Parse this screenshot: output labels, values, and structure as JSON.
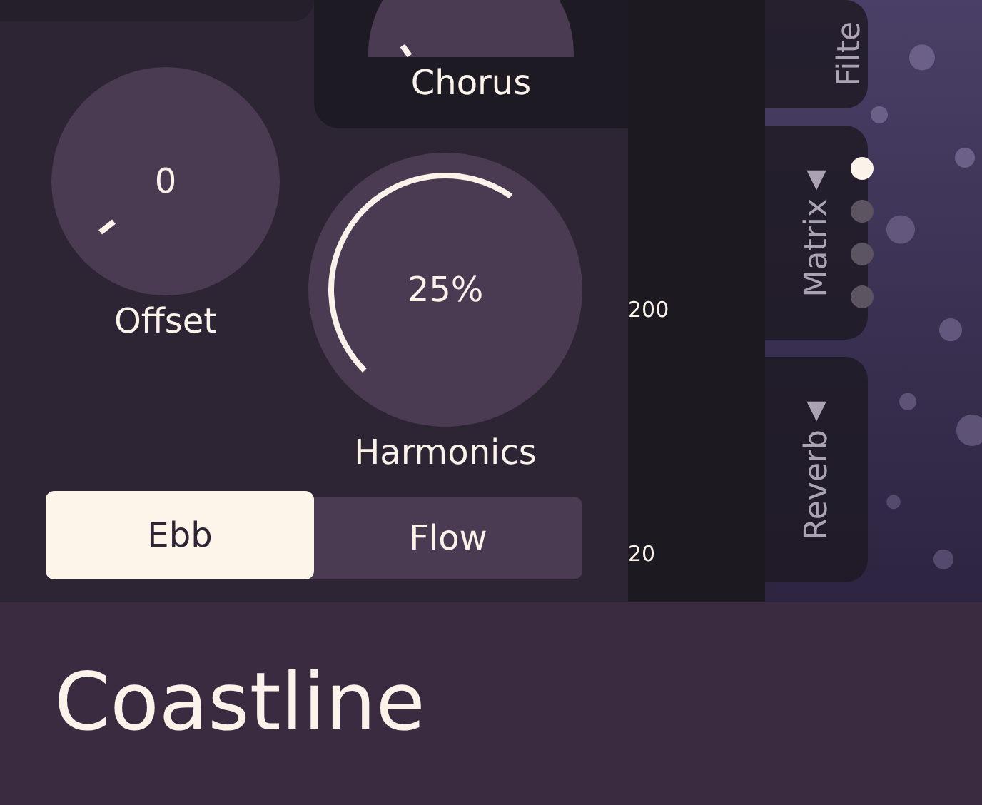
{
  "chorus": {
    "label": "Chorus"
  },
  "knobs": [
    {
      "kind": "tick",
      "value": "0",
      "label": "Offset"
    },
    {
      "kind": "arc",
      "value": "25%",
      "label": "Harmonics"
    }
  ],
  "mode_switch": [
    {
      "label": "Ebb",
      "selected": true
    },
    {
      "label": "Flow",
      "selected": false
    }
  ],
  "scale": [
    "200",
    "20"
  ],
  "tabs": [
    {
      "label": "Filte"
    },
    {
      "label": "Matrix",
      "arrow": "▼"
    },
    {
      "label": "Reverb",
      "arrow": "▼"
    }
  ],
  "pages": [
    {
      "selected": true
    },
    {
      "selected": false
    },
    {
      "selected": false
    },
    {
      "selected": false
    }
  ],
  "preset": {
    "name": "Coastline"
  }
}
